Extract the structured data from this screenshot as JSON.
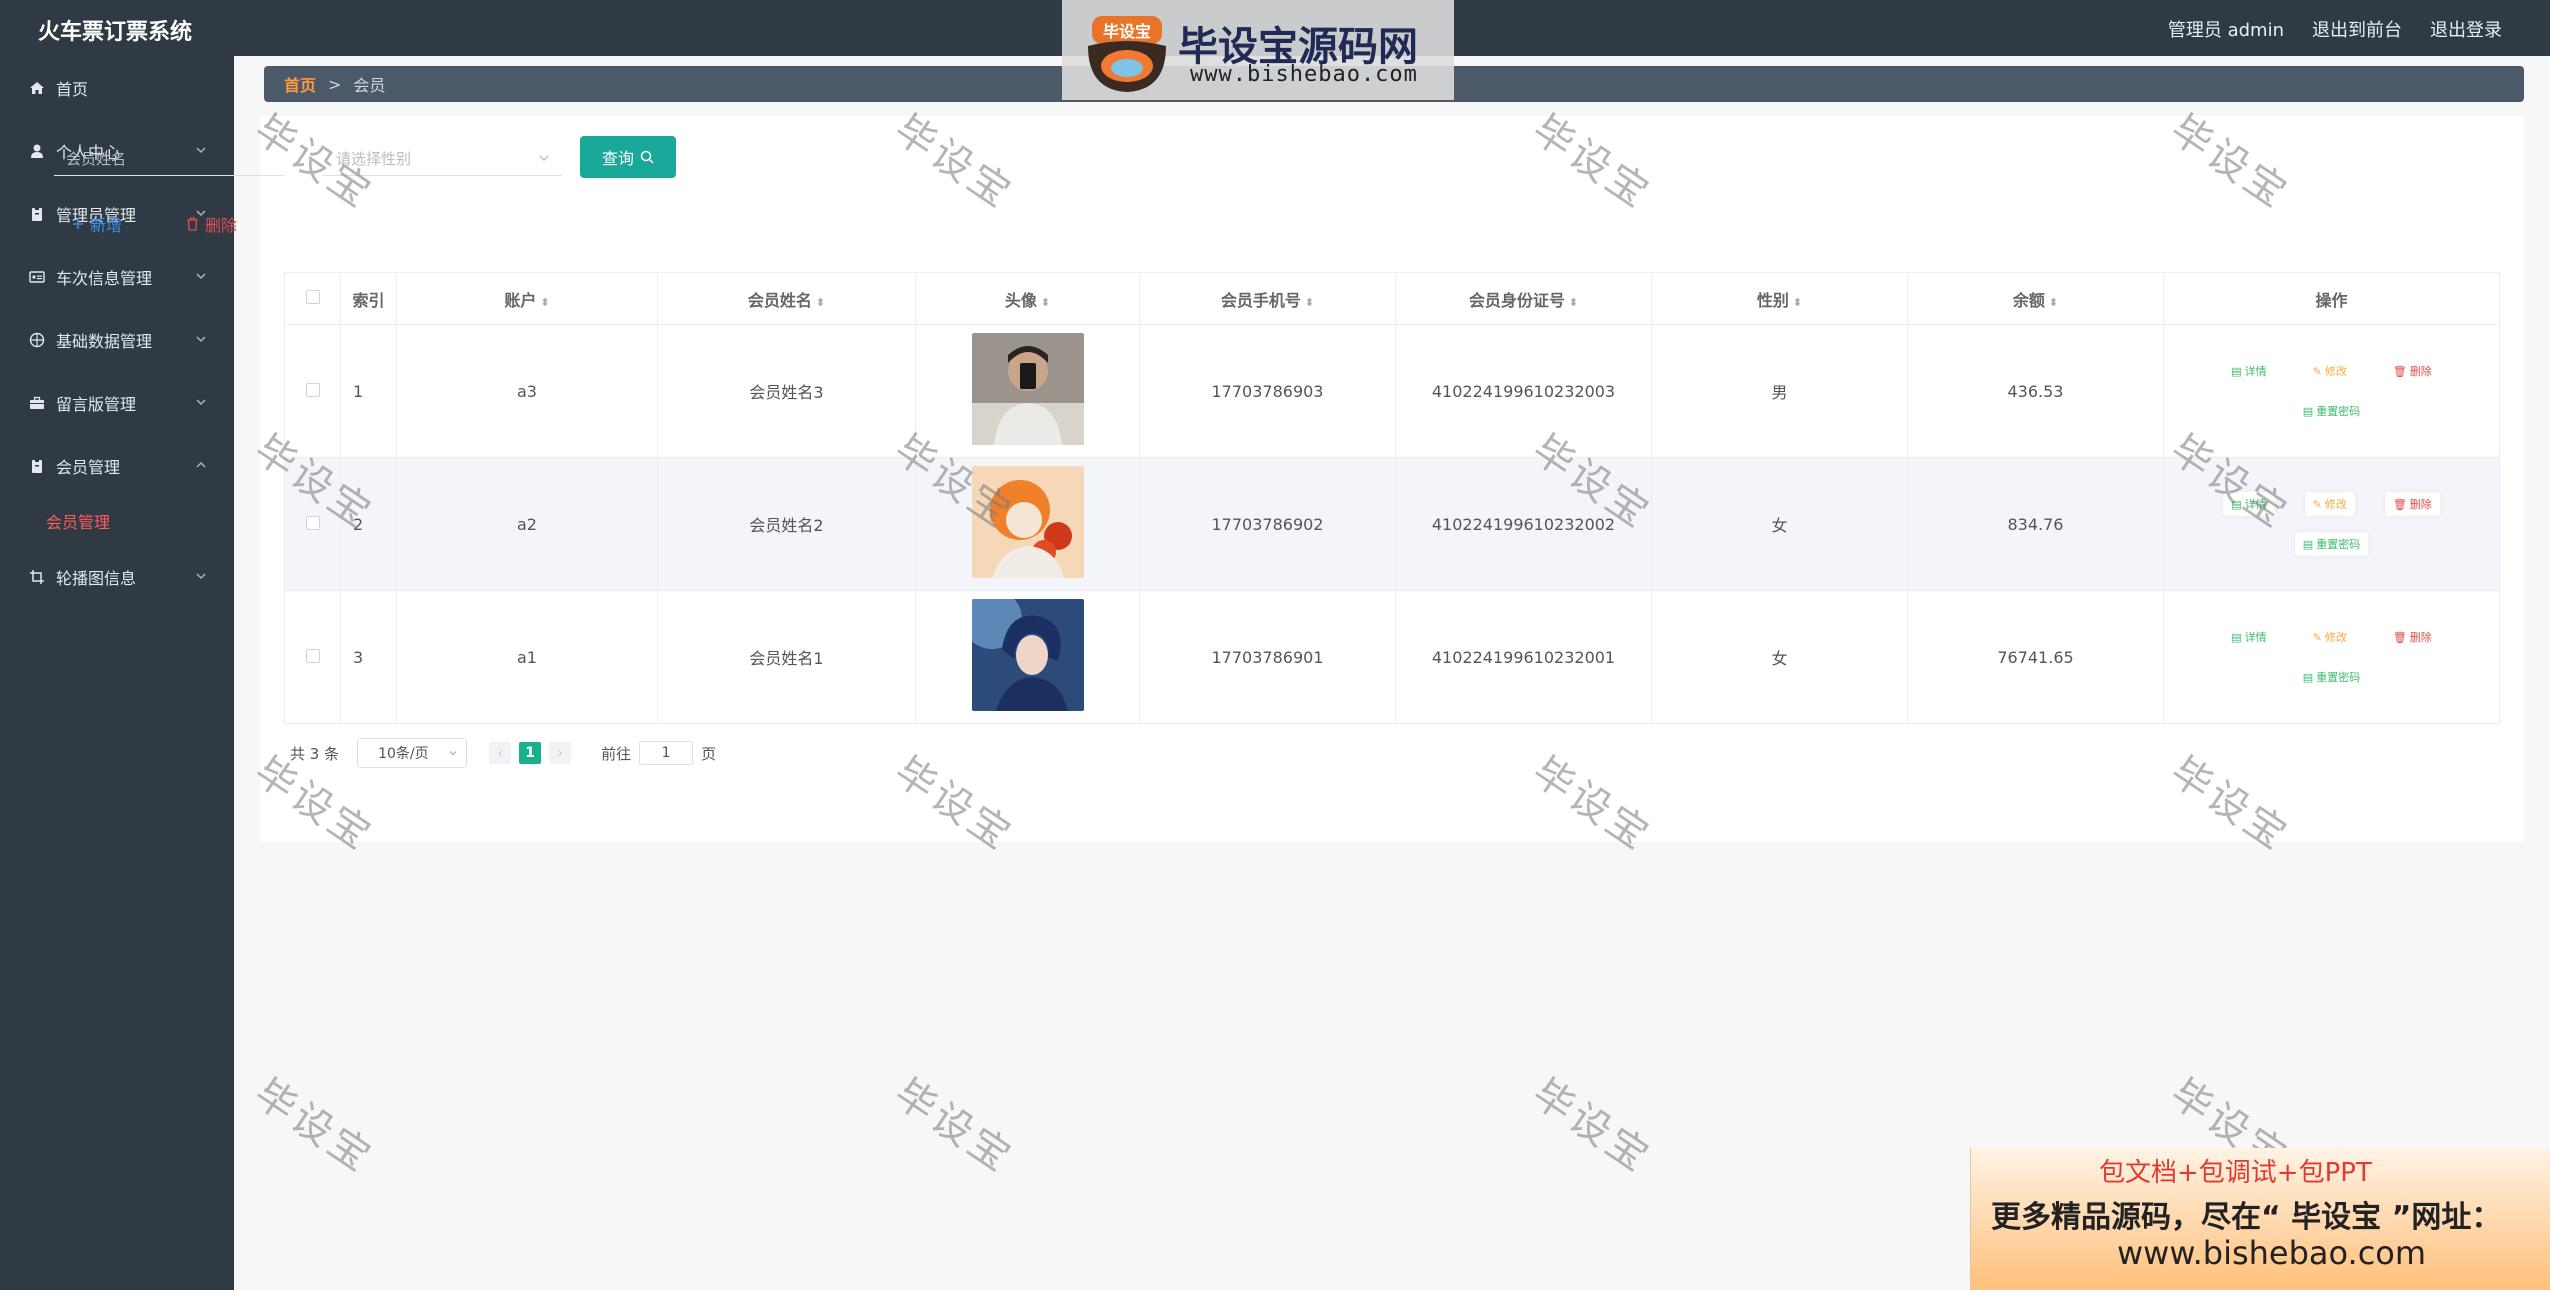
{
  "header": {
    "app_title": "火车票订票系统",
    "admin_label": "管理员 admin",
    "front_label": "退出到前台",
    "logout_label": "退出登录"
  },
  "sidebar": {
    "items": [
      {
        "label": "首页",
        "icon": "home-icon"
      },
      {
        "label": "个人中心",
        "icon": "user-icon"
      },
      {
        "label": "管理员管理",
        "icon": "clipboard-icon"
      },
      {
        "label": "车次信息管理",
        "icon": "id-card-icon"
      },
      {
        "label": "基础数据管理",
        "icon": "aperture-icon"
      },
      {
        "label": "留言版管理",
        "icon": "briefcase-icon"
      },
      {
        "label": "会员管理",
        "icon": "clipboard-icon"
      },
      {
        "label": "轮播图信息",
        "icon": "crop-icon"
      }
    ],
    "active_sub": "会员管理"
  },
  "breadcrumb": {
    "home": "首页",
    "sep": ">",
    "current": "会员"
  },
  "search": {
    "name_placeholder": "会员姓名",
    "gender_placeholder": "请选择性别",
    "query_label": "查询"
  },
  "actions": {
    "add_label": "新增",
    "delete_label": "删除"
  },
  "table": {
    "headers": [
      "索引",
      "账户",
      "会员姓名",
      "头像",
      "会员手机号",
      "会员身份证号",
      "性别",
      "余额",
      "操作"
    ],
    "rows": [
      {
        "index": "1",
        "account": "a3",
        "name": "会员姓名3",
        "phone": "17703786903",
        "idcard": "410224199610232003",
        "gender": "男",
        "balance": "436.53"
      },
      {
        "index": "2",
        "account": "a2",
        "name": "会员姓名2",
        "phone": "17703786902",
        "idcard": "410224199610232002",
        "gender": "女",
        "balance": "834.76"
      },
      {
        "index": "3",
        "account": "a1",
        "name": "会员姓名1",
        "phone": "17703786901",
        "idcard": "410224199610232001",
        "gender": "女",
        "balance": "76741.65"
      }
    ],
    "ops": {
      "detail": "详情",
      "edit": "修改",
      "delete": "删除",
      "reset": "重置密码"
    }
  },
  "pager": {
    "total": "共 3 条",
    "page_size": "10条/页",
    "current": "1",
    "goto_prefix": "前往",
    "goto_value": "1",
    "goto_suffix": "页"
  },
  "watermark_text": "毕设宝",
  "logo_banner": {
    "badge_text": "毕设宝",
    "title": "毕设宝源码网",
    "url": "www.bishebao.com"
  },
  "ad": {
    "line1": "包文档+包调试+包PPT",
    "line2": "更多精品源码，尽在“ 毕设宝 ”网址：",
    "line3": "www.bishebao.com"
  },
  "colors": {
    "sidebar_bg": "#2f3a45",
    "primary_btn": "#1aa89a",
    "active_menu": "#ff5c5c",
    "pager_active": "#19b08e"
  }
}
